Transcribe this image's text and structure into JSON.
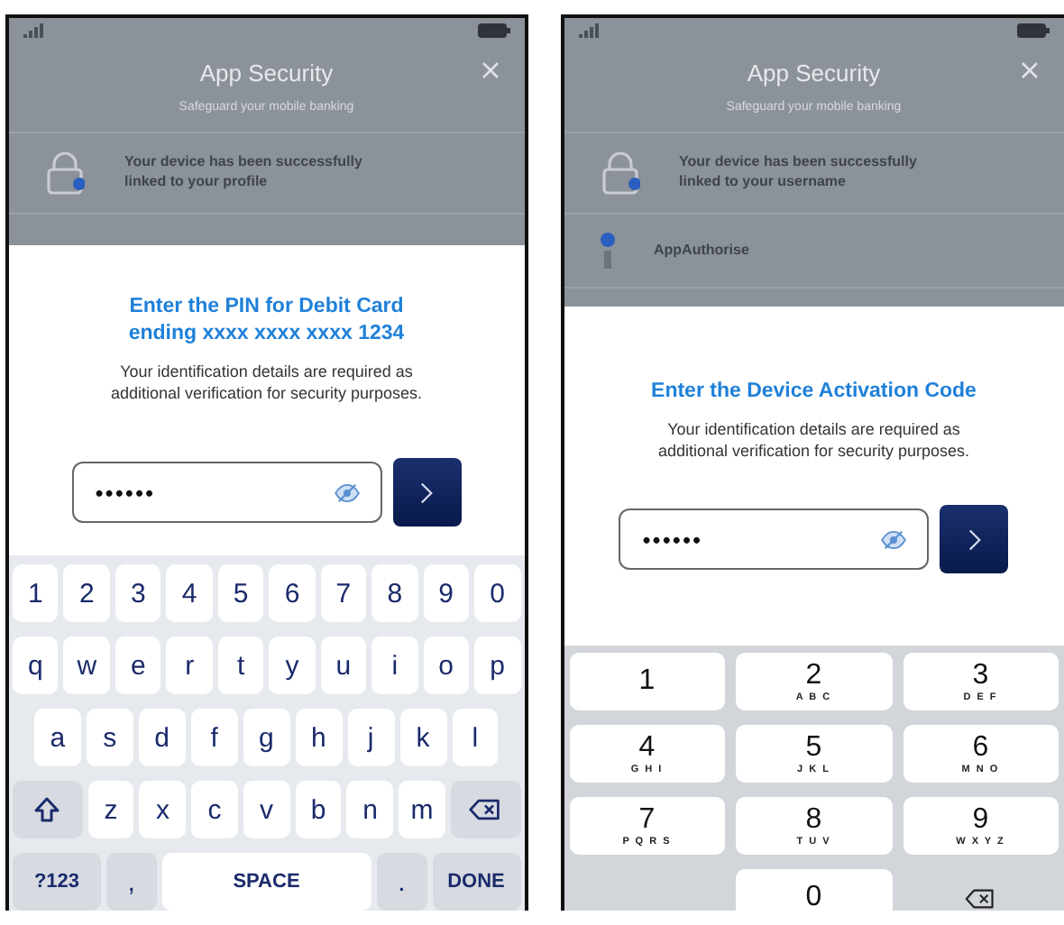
{
  "phones": [
    {
      "overlay": {
        "title": "App Security",
        "subtitle": "Safeguard your mobile banking",
        "rows": [
          {
            "kind": "lock",
            "text": "Your device has been successfully linked to your profile"
          }
        ]
      },
      "sheet": {
        "heading": "Enter the PIN for Debit Card ending xxxx xxxx xxxx 1234",
        "body": "Your identification details are required as additional verification for security purposes.",
        "pin": "••••••"
      },
      "keyboard": {
        "kind": "qwerty",
        "rows": [
          {
            "keys": [
              {
                "kind": "char",
                "label": "1"
              },
              {
                "kind": "char",
                "label": "2"
              },
              {
                "kind": "char",
                "label": "3"
              },
              {
                "kind": "char",
                "label": "4"
              },
              {
                "kind": "char",
                "label": "5"
              },
              {
                "kind": "char",
                "label": "6"
              },
              {
                "kind": "char",
                "label": "7"
              },
              {
                "kind": "char",
                "label": "8"
              },
              {
                "kind": "char",
                "label": "9"
              },
              {
                "kind": "char",
                "label": "0"
              }
            ]
          },
          {
            "keys": [
              {
                "kind": "char",
                "label": "q"
              },
              {
                "kind": "char",
                "label": "w"
              },
              {
                "kind": "char",
                "label": "e"
              },
              {
                "kind": "char",
                "label": "r"
              },
              {
                "kind": "char",
                "label": "t"
              },
              {
                "kind": "char",
                "label": "y"
              },
              {
                "kind": "char",
                "label": "u"
              },
              {
                "kind": "char",
                "label": "i"
              },
              {
                "kind": "char",
                "label": "o"
              },
              {
                "kind": "char",
                "label": "p"
              }
            ]
          },
          {
            "keys": [
              {
                "kind": "char",
                "label": "a"
              },
              {
                "kind": "char",
                "label": "s"
              },
              {
                "kind": "char",
                "label": "d"
              },
              {
                "kind": "char",
                "label": "f"
              },
              {
                "kind": "char",
                "label": "g"
              },
              {
                "kind": "char",
                "label": "h"
              },
              {
                "kind": "char",
                "label": "j"
              },
              {
                "kind": "char",
                "label": "k"
              },
              {
                "kind": "char",
                "label": "l"
              }
            ]
          },
          {
            "keys": [
              {
                "kind": "shift"
              },
              {
                "kind": "char",
                "label": "z"
              },
              {
                "kind": "char",
                "label": "x"
              },
              {
                "kind": "char",
                "label": "c"
              },
              {
                "kind": "char",
                "label": "v"
              },
              {
                "kind": "char",
                "label": "b"
              },
              {
                "kind": "char",
                "label": "n"
              },
              {
                "kind": "char",
                "label": "m"
              },
              {
                "kind": "backspace"
              }
            ]
          },
          {
            "keys": [
              {
                "kind": "mode",
                "label": "?123"
              },
              {
                "kind": "punct",
                "label": ","
              },
              {
                "kind": "space",
                "label": "SPACE"
              },
              {
                "kind": "punct",
                "label": "."
              },
              {
                "kind": "done",
                "label": "DONE"
              }
            ]
          }
        ]
      }
    },
    {
      "overlay": {
        "title": "App Security",
        "subtitle": "Safeguard your mobile banking",
        "rows": [
          {
            "kind": "lock",
            "text": "Your device has been successfully linked to your username"
          },
          {
            "kind": "authorise",
            "text": "AppAuthorise"
          }
        ]
      },
      "sheet": {
        "heading": "Enter the Device Activation Code",
        "body": "Your identification details are required as additional verification for security purposes.",
        "pin": "••••••"
      },
      "keyboard": {
        "kind": "numpad",
        "rows": [
          [
            {
              "kind": "digit",
              "label": "1"
            },
            {
              "kind": "digit",
              "label": "2",
              "letters": "A B C"
            },
            {
              "kind": "digit",
              "label": "3",
              "letters": "D E F"
            }
          ],
          [
            {
              "kind": "digit",
              "label": "4",
              "letters": "G H I"
            },
            {
              "kind": "digit",
              "label": "5",
              "letters": "J K L"
            },
            {
              "kind": "digit",
              "label": "6",
              "letters": "M N O"
            }
          ],
          [
            {
              "kind": "digit",
              "label": "7",
              "letters": "P Q R S"
            },
            {
              "kind": "digit",
              "label": "8",
              "letters": "T U V"
            },
            {
              "kind": "digit",
              "label": "9",
              "letters": "W X Y Z"
            }
          ],
          [
            {
              "kind": "blank"
            },
            {
              "kind": "digit",
              "label": "0"
            },
            {
              "kind": "backspace"
            }
          ]
        ]
      }
    }
  ]
}
